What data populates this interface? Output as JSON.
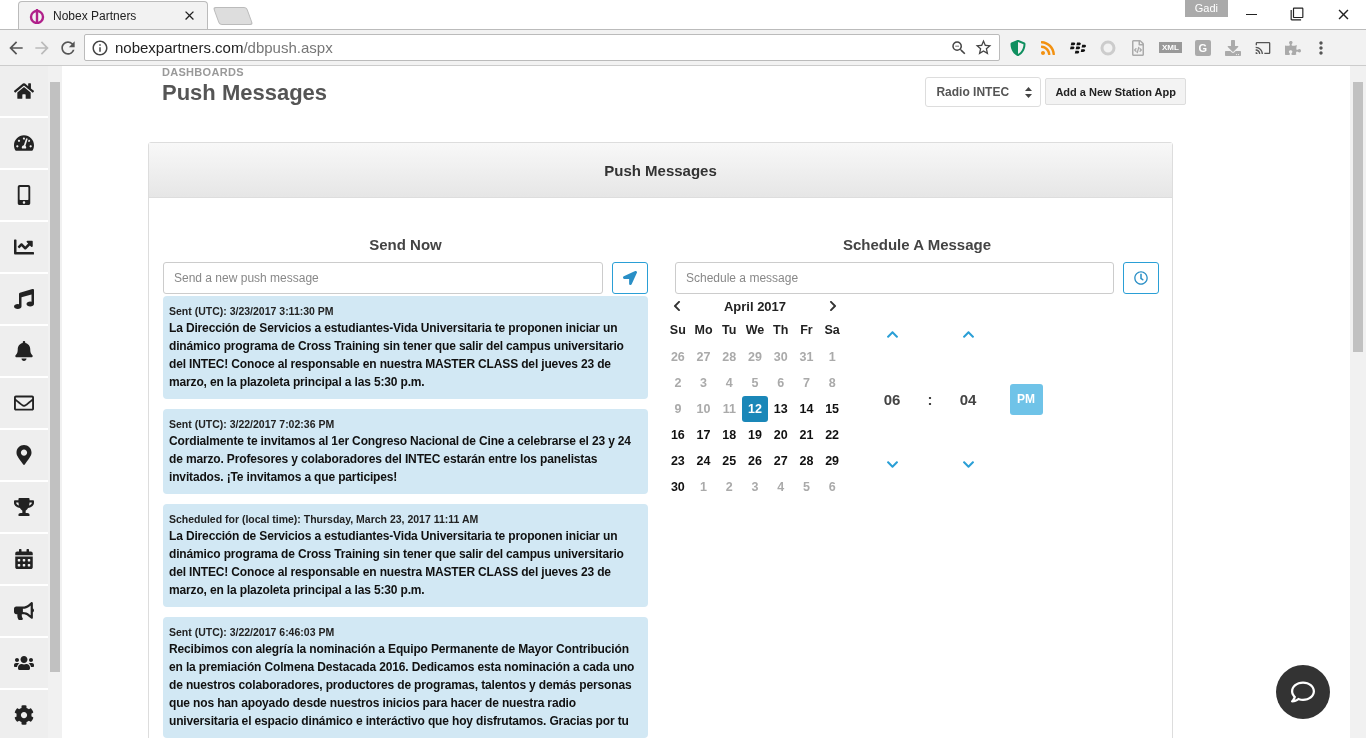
{
  "browser": {
    "tab_title": "Nobex Partners",
    "url_host": "nobexpartners.com",
    "url_path": "/dbpush.aspx",
    "profile": "Gadi",
    "extension_labels": [
      "XML",
      "G"
    ]
  },
  "page": {
    "breadcrumb": "DASHBOARDS",
    "title": "Push Messages",
    "station": "Radio INTEC",
    "add_button": "Add a New Station App"
  },
  "panel": {
    "title": "Push Messages",
    "send_now": {
      "heading": "Send Now",
      "placeholder": "Send a new push message",
      "messages": [
        {
          "meta": "Sent (UTC): 3/23/2017 3:11:30 PM",
          "text": "La Dirección de Servicios a estudiantes-Vida Universitaria te proponen iniciar un dinámico programa de Cross Training sin tener que salir del campus universitario del INTEC! Conoce al responsable en nuestra MASTER CLASS del jueves 23 de marzo, en la plazoleta principal a las 5:30 p.m."
        },
        {
          "meta": "Sent (UTC): 3/22/2017 7:02:36 PM",
          "text": "Cordialmente te invitamos al 1er Congreso Nacional de Cine a celebrarse el 23 y 24 de marzo. Profesores y colaboradores del INTEC estarán entre los panelistas invitados. ¡Te invitamos a que participes!"
        },
        {
          "meta": "Scheduled for (local time): Thursday, March 23, 2017 11:11 AM",
          "text": "La Dirección de Servicios a estudiantes-Vida Universitaria te proponen iniciar un dinámico programa de Cross Training sin tener que salir del campus universitario del INTEC! Conoce al responsable en nuestra MASTER CLASS del jueves 23 de marzo, en la plazoleta principal a las 5:30 p.m."
        },
        {
          "meta": "Sent (UTC): 3/22/2017 6:46:03 PM",
          "text": "Recibimos con alegría la nominación a Equipo Permanente de Mayor Contribución en la premiación Colmena Destacada 2016. Dedicamos esta nominación a cada uno de nuestros colaboradores, productores de programas, talentos y demás personas que nos han apoyado desde nuestros inicios para hacer de nuestra radio universitaria el espacio dinámico e interáctivo que hoy disfrutamos. Gracias por tu"
        }
      ]
    },
    "schedule": {
      "heading": "Schedule A Message",
      "placeholder": "Schedule a message",
      "calendar": {
        "month": "April 2017",
        "weekdays": [
          "Su",
          "Mo",
          "Tu",
          "We",
          "Th",
          "Fr",
          "Sa"
        ],
        "weeks": [
          [
            {
              "label": "26",
              "disabled": true,
              "selected": false
            },
            {
              "label": "27",
              "disabled": true,
              "selected": false
            },
            {
              "label": "28",
              "disabled": true,
              "selected": false
            },
            {
              "label": "29",
              "disabled": true,
              "selected": false
            },
            {
              "label": "30",
              "disabled": true,
              "selected": false
            },
            {
              "label": "31",
              "disabled": true,
              "selected": false
            },
            {
              "label": "1",
              "disabled": true,
              "selected": false
            }
          ],
          [
            {
              "label": "2",
              "disabled": true,
              "selected": false
            },
            {
              "label": "3",
              "disabled": true,
              "selected": false
            },
            {
              "label": "4",
              "disabled": true,
              "selected": false
            },
            {
              "label": "5",
              "disabled": true,
              "selected": false
            },
            {
              "label": "6",
              "disabled": true,
              "selected": false
            },
            {
              "label": "7",
              "disabled": true,
              "selected": false
            },
            {
              "label": "8",
              "disabled": true,
              "selected": false
            }
          ],
          [
            {
              "label": "9",
              "disabled": true,
              "selected": false
            },
            {
              "label": "10",
              "disabled": true,
              "selected": false
            },
            {
              "label": "11",
              "disabled": true,
              "selected": false
            },
            {
              "label": "12",
              "disabled": false,
              "selected": true
            },
            {
              "label": "13",
              "disabled": false,
              "selected": false
            },
            {
              "label": "14",
              "disabled": false,
              "selected": false
            },
            {
              "label": "15",
              "disabled": false,
              "selected": false
            }
          ],
          [
            {
              "label": "16",
              "disabled": false,
              "selected": false
            },
            {
              "label": "17",
              "disabled": false,
              "selected": false
            },
            {
              "label": "18",
              "disabled": false,
              "selected": false
            },
            {
              "label": "19",
              "disabled": false,
              "selected": false
            },
            {
              "label": "20",
              "disabled": false,
              "selected": false
            },
            {
              "label": "21",
              "disabled": false,
              "selected": false
            },
            {
              "label": "22",
              "disabled": false,
              "selected": false
            }
          ],
          [
            {
              "label": "23",
              "disabled": false,
              "selected": false
            },
            {
              "label": "24",
              "disabled": false,
              "selected": false
            },
            {
              "label": "25",
              "disabled": false,
              "selected": false
            },
            {
              "label": "26",
              "disabled": false,
              "selected": false
            },
            {
              "label": "27",
              "disabled": false,
              "selected": false
            },
            {
              "label": "28",
              "disabled": false,
              "selected": false
            },
            {
              "label": "29",
              "disabled": false,
              "selected": false
            }
          ],
          [
            {
              "label": "30",
              "disabled": false,
              "selected": false
            },
            {
              "label": "1",
              "disabled": true,
              "selected": false
            },
            {
              "label": "2",
              "disabled": true,
              "selected": false
            },
            {
              "label": "3",
              "disabled": true,
              "selected": false
            },
            {
              "label": "4",
              "disabled": true,
              "selected": false
            },
            {
              "label": "5",
              "disabled": true,
              "selected": false
            },
            {
              "label": "6",
              "disabled": true,
              "selected": false
            }
          ]
        ]
      },
      "time": {
        "hours": "06",
        "separator": ":",
        "minutes": "04",
        "meridiem": "PM"
      }
    }
  }
}
